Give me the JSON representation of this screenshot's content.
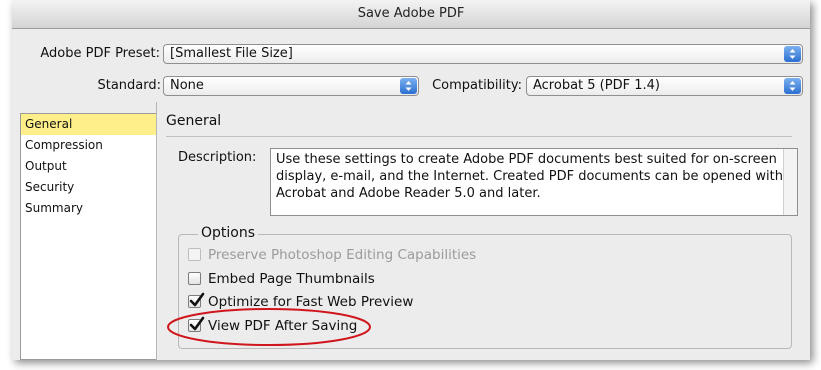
{
  "window": {
    "title": "Save Adobe PDF"
  },
  "preset": {
    "label": "Adobe PDF Preset:",
    "value": "[Smallest File Size]"
  },
  "standard": {
    "label": "Standard:",
    "value": "None"
  },
  "compatibility": {
    "label": "Compatibility:",
    "value": "Acrobat 5 (PDF 1.4)"
  },
  "sidebar": {
    "items": [
      {
        "label": "General",
        "selected": true
      },
      {
        "label": "Compression",
        "selected": false
      },
      {
        "label": "Output",
        "selected": false
      },
      {
        "label": "Security",
        "selected": false
      },
      {
        "label": "Summary",
        "selected": false
      }
    ]
  },
  "general": {
    "title": "General",
    "description_label": "Description:",
    "description_text": "Use these settings to create Adobe PDF documents best suited for on-screen display, e-mail, and the Internet.  Created PDF documents can be opened with Acrobat and Adobe Reader 5.0 and later."
  },
  "options": {
    "legend": "Options",
    "items": [
      {
        "label": "Preserve Photoshop Editing Capabilities",
        "checked": false,
        "disabled": true
      },
      {
        "label": "Embed Page Thumbnails",
        "checked": false,
        "disabled": false
      },
      {
        "label": "Optimize for Fast Web Preview",
        "checked": true,
        "disabled": false
      },
      {
        "label": "View PDF After Saving",
        "checked": true,
        "disabled": false
      }
    ]
  },
  "colors": {
    "accent": "#2d6fd1",
    "selection": "#ffef8a",
    "annotation": "#d0161c"
  }
}
